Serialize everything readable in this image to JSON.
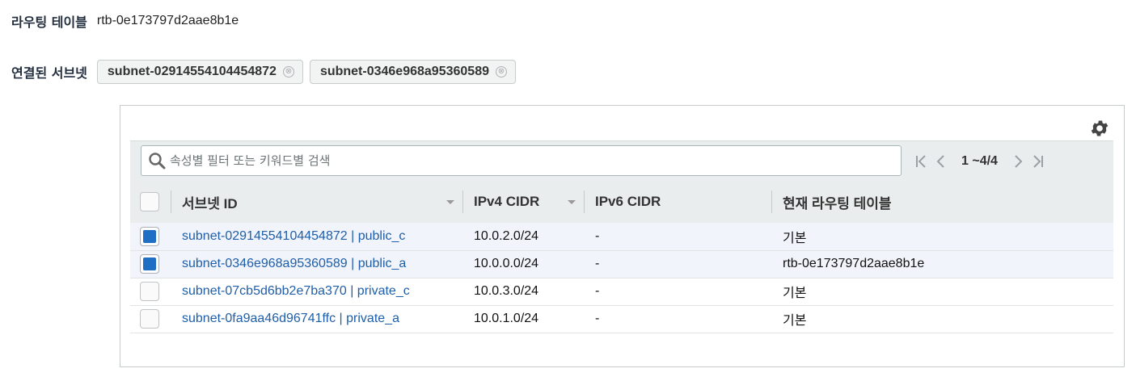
{
  "route_table": {
    "label": "라우팅 테이블",
    "value": "rtb-0e173797d2aae8b1e"
  },
  "associated_subnets": {
    "label": "연결된 서브넷",
    "tokens": [
      "subnet-02914554104454872",
      "subnet-0346e968a95360589"
    ],
    "remove_glyph": "⊗"
  },
  "toolbar": {
    "settings_icon": "gear-icon",
    "search_placeholder": "속성별 필터 또는 키워드별 검색",
    "pagination_text": "1 ~4/4"
  },
  "table": {
    "headers": [
      "서브넷 ID",
      "IPv4 CIDR",
      "IPv6 CIDR",
      "현재 라우팅 테이블"
    ],
    "rows": [
      {
        "selected": true,
        "subnet": "subnet-02914554104454872 | public_c",
        "ipv4": "10.0.2.0/24",
        "ipv6": "-",
        "route_table": "기본"
      },
      {
        "selected": true,
        "subnet": "subnet-0346e968a95360589 | public_a",
        "ipv4": "10.0.0.0/24",
        "ipv6": "-",
        "route_table": "rtb-0e173797d2aae8b1e"
      },
      {
        "selected": false,
        "subnet": "subnet-07cb5d6bb2e7ba370 | private_c",
        "ipv4": "10.0.3.0/24",
        "ipv6": "-",
        "route_table": "기본"
      },
      {
        "selected": false,
        "subnet": "subnet-0fa9aa46d96741ffc | private_a",
        "ipv4": "10.0.1.0/24",
        "ipv6": "-",
        "route_table": "기본"
      }
    ]
  },
  "colors": {
    "link": "#1f5ea8",
    "checkbox": "#1f6fc5",
    "selected_row": "#f1f4fb",
    "toolbar_bg": "#eaeded"
  }
}
